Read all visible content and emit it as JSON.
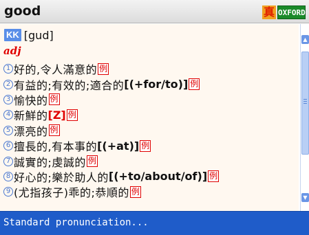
{
  "header": {
    "word": "good",
    "badge_zhen": "真",
    "badge_oxford": "OXFORD"
  },
  "entry": {
    "kk_label": "KK",
    "phonetic": "[gud]",
    "pos": "adj",
    "example_marker": "例",
    "senses": [
      {
        "num": "1",
        "text": "好的,令人滿意的",
        "gram": "",
        "gram_red": ""
      },
      {
        "num": "2",
        "text": "有益的;有效的;適合的",
        "gram": "[(+for/to)]",
        "gram_red": ""
      },
      {
        "num": "3",
        "text": "愉快的",
        "gram": "",
        "gram_red": ""
      },
      {
        "num": "4",
        "text": "新鮮的",
        "gram": "",
        "gram_red": "[Z]"
      },
      {
        "num": "5",
        "text": "漂亮的",
        "gram": "",
        "gram_red": ""
      },
      {
        "num": "6",
        "text": "擅長的,有本事的",
        "gram": "[(+at)]",
        "gram_red": ""
      },
      {
        "num": "7",
        "text": "誠實的;虔誠的",
        "gram": "",
        "gram_red": ""
      },
      {
        "num": "8",
        "text": "好心的;樂於助人的",
        "gram": "[(+to/about/of)]",
        "gram_red": ""
      },
      {
        "num": "9",
        "text": "(尤指孩子)乖的;恭順的",
        "gram": "",
        "gram_red": ""
      }
    ]
  },
  "status": {
    "text": "Standard pronunciation..."
  },
  "colors": {
    "accent": "#1f5cc9",
    "headword_pos": "#e00000",
    "number_circle": "#4a78d0",
    "oxford_badge": "#1a8a2a"
  }
}
